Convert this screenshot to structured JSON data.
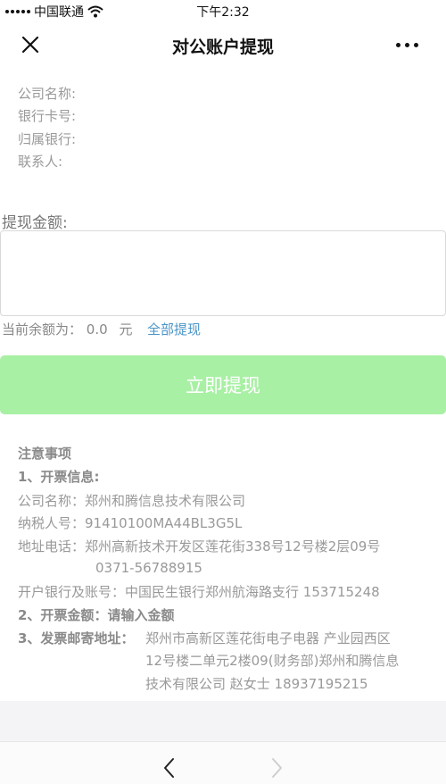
{
  "status_bar": {
    "carrier": "中国联通",
    "time": "下午2:32"
  },
  "nav": {
    "title": "对公账户提现",
    "close_icon": "close-icon",
    "more_icon": "more-icon"
  },
  "account": {
    "company_label": "公司名称:",
    "card_label": "银行卡号:",
    "bank_label": "归属银行:",
    "contact_label": "联系人:"
  },
  "withdraw": {
    "amount_label": "提现金额:",
    "amount_value": "",
    "balance_label": "当前余额为：",
    "balance_value": "0.0",
    "balance_unit": "元",
    "withdraw_all": "全部提现",
    "submit": "立即提现"
  },
  "notes": {
    "title": "注意事项",
    "invoice_info_title": "1、开票信息:",
    "company": "公司名称：郑州和腾信息技术有限公司",
    "tax_id": "纳税人号：91410100MA44BL3G5L",
    "address_phone": "地址电话：郑州高新技术开发区莲花街338号12号楼2层09号",
    "phone": "0371-56788915",
    "bank_account": "开户银行及账号：中国民生银行郑州航海路支行    153715248",
    "invoice_amount": "2、开票金额：请输入金额",
    "mail_address_label": "3、发票邮寄地址：",
    "mail_address_line1": "郑州市高新区莲花街电子电器 产业园西区",
    "mail_address_line2": "12号楼二单元2楼09(财务部)郑州和腾信息",
    "mail_address_line3": "技术有限公司 赵女士 18937195215"
  },
  "toolbar": {
    "back_icon": "chevron-left-icon",
    "forward_icon": "chevron-right-icon"
  },
  "colors": {
    "submit_bg": "#a8f0a4",
    "link": "#4b95c8",
    "muted_text": "#999999"
  }
}
